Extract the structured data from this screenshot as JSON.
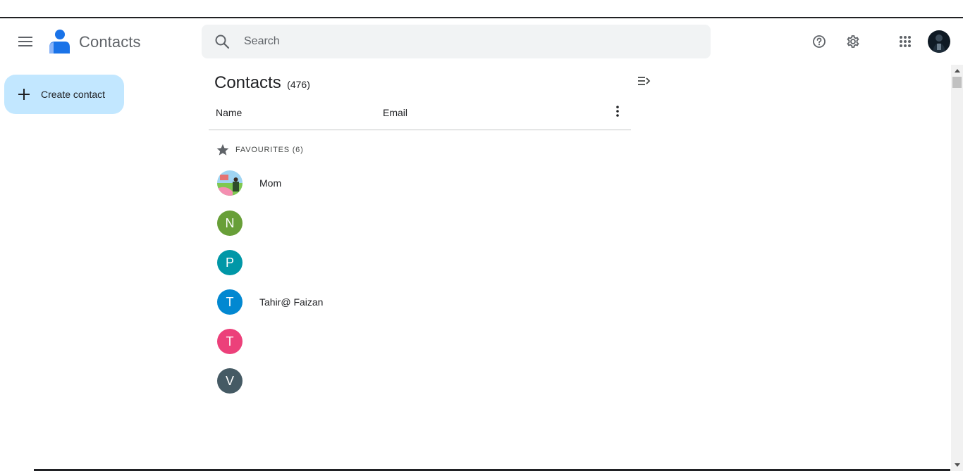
{
  "app": {
    "title": "Contacts",
    "brand_color": "#1a73e8"
  },
  "header": {
    "menu_icon": "hamburger-menu-icon",
    "search_placeholder": "Search",
    "help_icon": "help-icon",
    "settings_icon": "gear-icon",
    "apps_icon": "apps-grid-icon",
    "avatar_icon": "account-avatar"
  },
  "sidebar": {
    "create_label": "Create contact",
    "create_color": "#c2e7ff"
  },
  "main": {
    "title": "Contacts",
    "count": "(476)",
    "columns": {
      "name": "Name",
      "email": "Email"
    },
    "favourites_label": "FAVOURITES (6)",
    "contacts": [
      {
        "initial": "",
        "name": "Mom",
        "color": "",
        "photo": true
      },
      {
        "initial": "N",
        "name": "",
        "color": "#689f38"
      },
      {
        "initial": "P",
        "name": "",
        "color": "#0097a7"
      },
      {
        "initial": "T",
        "name": "Tahir@ Faizan",
        "color": "#0288d1"
      },
      {
        "initial": "T",
        "name": "",
        "color": "#ec407a"
      },
      {
        "initial": "V",
        "name": "",
        "color": "#455a64"
      }
    ]
  }
}
